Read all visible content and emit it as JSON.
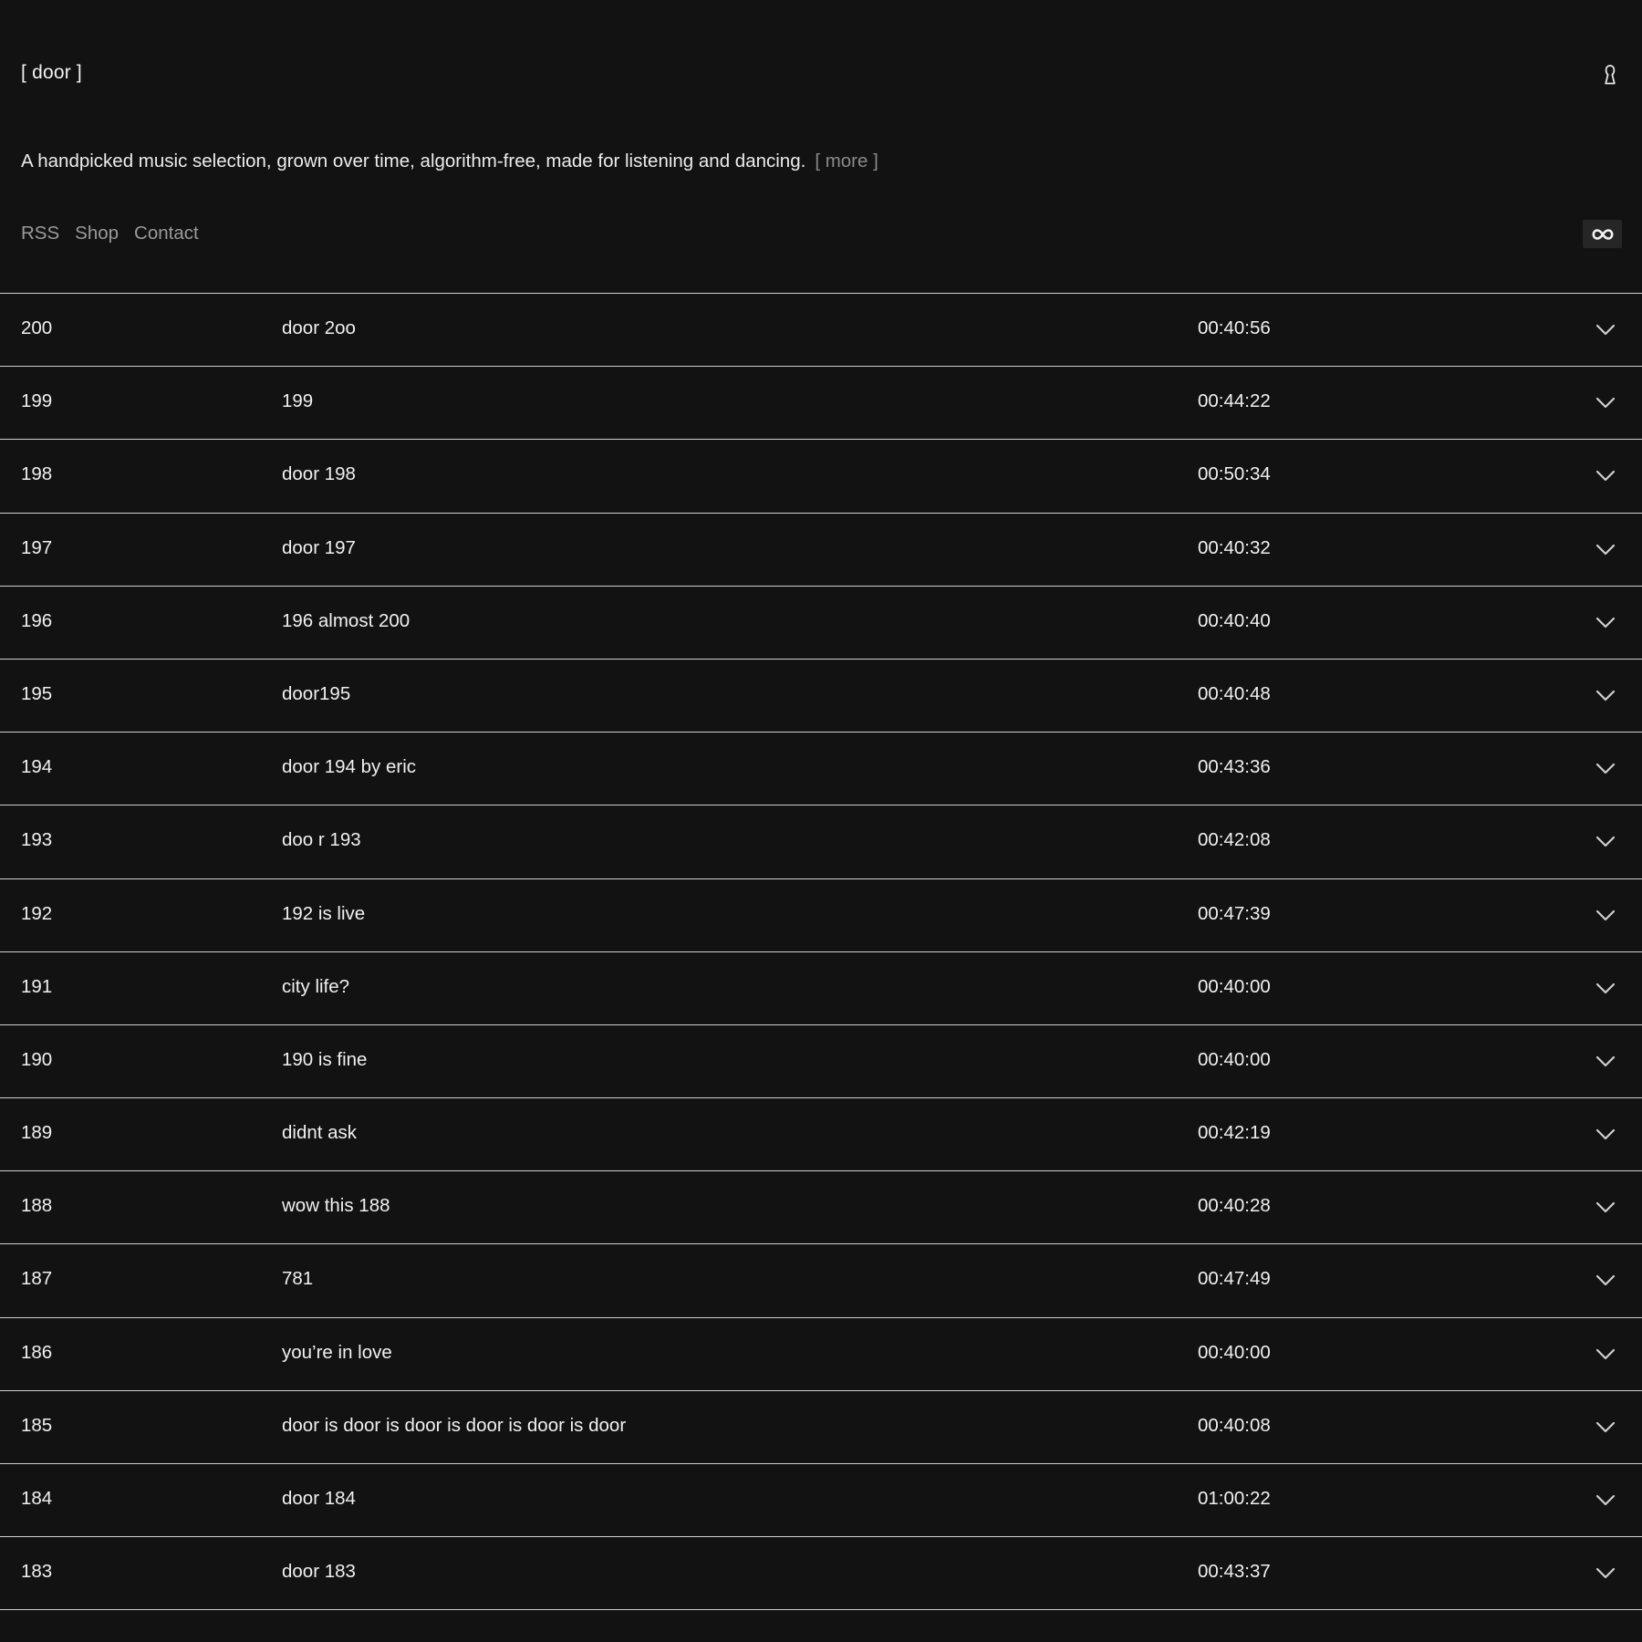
{
  "site": {
    "logo": "[ door ]",
    "description": "A handpicked music selection, grown over time, algorithm-free, made for listening and dancing.",
    "more_label": "[ more ]"
  },
  "nav": {
    "items": [
      {
        "label": "RSS"
      },
      {
        "label": "Shop"
      },
      {
        "label": "Contact"
      }
    ]
  },
  "icons": {
    "top_right": "lock-icon",
    "loop_toggle": "infinity-icon",
    "row_expand": "chevron-down-icon"
  },
  "colors": {
    "background": "#121212",
    "text": "#f0f0f0",
    "muted": "#8a8a8a",
    "divider": "#cfcfcf"
  },
  "episodes": [
    {
      "number": "200",
      "title": "door 2oo",
      "duration": "00:40:56"
    },
    {
      "number": "199",
      "title": "199",
      "duration": "00:44:22"
    },
    {
      "number": "198",
      "title": "door 198",
      "duration": "00:50:34"
    },
    {
      "number": "197",
      "title": "door 197",
      "duration": "00:40:32"
    },
    {
      "number": "196",
      "title": "196 almost 200",
      "duration": "00:40:40"
    },
    {
      "number": "195",
      "title": "door195",
      "duration": "00:40:48"
    },
    {
      "number": "194",
      "title": "door 194 by eric",
      "duration": "00:43:36"
    },
    {
      "number": "193",
      "title": "doo r 193",
      "duration": "00:42:08"
    },
    {
      "number": "192",
      "title": "192 is live",
      "duration": "00:47:39"
    },
    {
      "number": "191",
      "title": "city life?",
      "duration": "00:40:00"
    },
    {
      "number": "190",
      "title": "190 is fine",
      "duration": "00:40:00"
    },
    {
      "number": "189",
      "title": "didnt ask",
      "duration": "00:42:19"
    },
    {
      "number": "188",
      "title": "wow this 188",
      "duration": "00:40:28"
    },
    {
      "number": "187",
      "title": "781",
      "duration": "00:47:49"
    },
    {
      "number": "186",
      "title": "you’re in love",
      "duration": "00:40:00"
    },
    {
      "number": "185",
      "title": "door is door is door is door is door is door",
      "duration": "00:40:08"
    },
    {
      "number": "184",
      "title": "door 184",
      "duration": "01:00:22"
    },
    {
      "number": "183",
      "title": "door 183",
      "duration": "00:43:37"
    }
  ]
}
